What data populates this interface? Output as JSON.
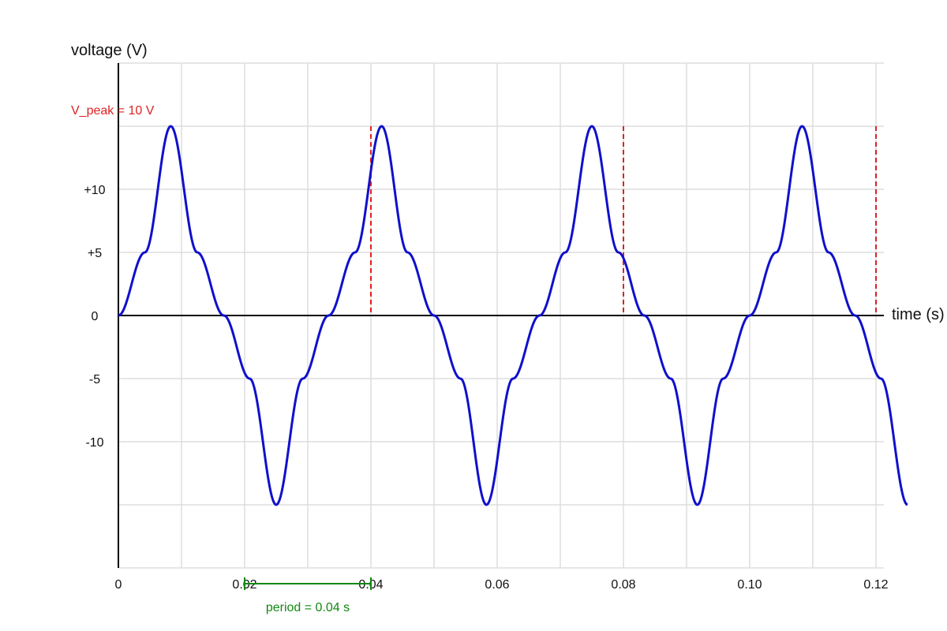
{
  "chart_data": {
    "type": "line",
    "title": "",
    "xlabel": "time (s)",
    "ylabel": "voltage (V)",
    "xlim": [
      0,
      0.12
    ],
    "ylim": [
      -20,
      20
    ],
    "grid": true,
    "x_ticks": [
      {
        "value": 0,
        "label": "0"
      },
      {
        "value": 0.02,
        "label": "0.02"
      },
      {
        "value": 0.04,
        "label": "0.04"
      },
      {
        "value": 0.06,
        "label": "0.06"
      },
      {
        "value": 0.08,
        "label": "0.08"
      },
      {
        "value": 0.1,
        "label": "0.10"
      },
      {
        "value": 0.12,
        "label": "0.12"
      }
    ],
    "y_ticks": [
      {
        "value": 10,
        "label": "+10"
      },
      {
        "value": 5,
        "label": "+5"
      },
      {
        "value": 0,
        "label": "0"
      },
      {
        "value": -5,
        "label": "-5"
      },
      {
        "value": -10,
        "label": "-10"
      }
    ],
    "series": [
      {
        "color": "#1010cc",
        "x": [
          0,
          0.0042,
          0.0083,
          0.0125,
          0.0167,
          0.0208,
          0.025,
          0.0292,
          0.0333,
          0.0375,
          0.0417,
          0.0458,
          0.05,
          0.0542,
          0.0583,
          0.0625,
          0.0667,
          0.0708,
          0.075,
          0.0792,
          0.0833,
          0.0875,
          0.0917,
          0.0958,
          0.1,
          0.1042,
          0.1083,
          0.1125,
          0.1167,
          0.1208,
          0.125
        ],
        "y": [
          0,
          5,
          15,
          5,
          0,
          -5,
          -15,
          -5,
          0,
          5,
          15,
          5,
          0,
          -5,
          -15,
          -5,
          0,
          5,
          15,
          5,
          0,
          -5,
          -15,
          -5,
          0,
          5,
          15,
          5,
          0,
          -5,
          -15
        ]
      }
    ],
    "annotations": {
      "peak_label": "V_peak = 10 V",
      "peak_color": "#dd2222",
      "dashed_markers_x": [
        0,
        0.04,
        0.08,
        0.12
      ],
      "period_label": "period = 0.04 s",
      "period_color": "#118811",
      "period_range": [
        0.02,
        0.04
      ]
    }
  }
}
